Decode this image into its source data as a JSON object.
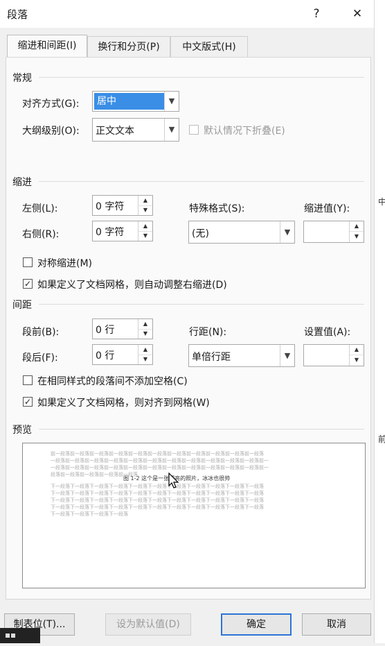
{
  "window": {
    "title": "段落",
    "help": "?",
    "close": "✕"
  },
  "tabs": [
    {
      "label": "缩进和间距(I)"
    },
    {
      "label": "换行和分页(P)"
    },
    {
      "label": "中文版式(H)"
    }
  ],
  "general": {
    "heading": "常规",
    "alignment_label": "对齐方式(G):",
    "alignment_value": "居中",
    "outline_label": "大纲级别(O):",
    "outline_value": "正文文本",
    "collapse_label": "默认情况下折叠(E)"
  },
  "indent": {
    "heading": "缩进",
    "left_label": "左侧(L):",
    "left_value": "0 字符",
    "right_label": "右侧(R):",
    "right_value": "0 字符",
    "special_label": "特殊格式(S):",
    "special_value": "(无)",
    "by_label": "缩进值(Y):",
    "by_value": "",
    "mirror_label": "对称缩进(M)",
    "auto_adjust_label": "如果定义了文档网格，则自动调整右缩进(D)"
  },
  "spacing": {
    "heading": "间距",
    "before_label": "段前(B):",
    "before_value": "0 行",
    "after_label": "段后(F):",
    "after_value": "0 行",
    "line_label": "行距(N):",
    "line_value": "单倍行距",
    "at_label": "设置值(A):",
    "at_value": "",
    "no_space_label": "在相同样式的段落间不添加空格(C)",
    "snap_grid_label": "如果定义了文档网格，则对齐到网格(W)"
  },
  "preview": {
    "heading": "预览",
    "prev_lines": [
      "前一段落前一段落前一段落前一段落前一段落前一段落前一段落前一段落前一段落前一段落前一段落",
      "一段落前一段落前一段落前一段落前一段落前一段落前一段落前一段落前一段落前一段落前一段落前一",
      "一段落前一段落前一段落前一段落前一段落前一段落前一段落前一段落前一段落前一段落前一段落前一",
      "段落前一段落前一段落前一段落前一段落"
    ],
    "sample": "图 1-2 这个是一张漂亮的照片，冰冰也很帅",
    "next_lines": [
      "下一段落下一段落下一段落下一段落下一段落下一段落下一段落下一段落下一段落下一段落下一段落",
      "下一段落下一段落下一段落下一段落下一段落下一段落下一段落下一段落下一段落下一段落下一段落",
      "下一段落下一段落下一段落下一段落下一段落下一段落下一段落下一段落下一段落下一段落下一段落",
      "下一段落下一段落下一段落下一段落下一段落下一段落下一段落下一段落下一段落下一段落下一段落",
      "下一段落下一段落下一段落下一段落"
    ]
  },
  "buttons": {
    "tabs": "制表位(T)...",
    "set_default": "设为默认值(D)",
    "ok": "确定",
    "cancel": "取消"
  },
  "side": {
    "c1": "中",
    "c2": "前"
  }
}
